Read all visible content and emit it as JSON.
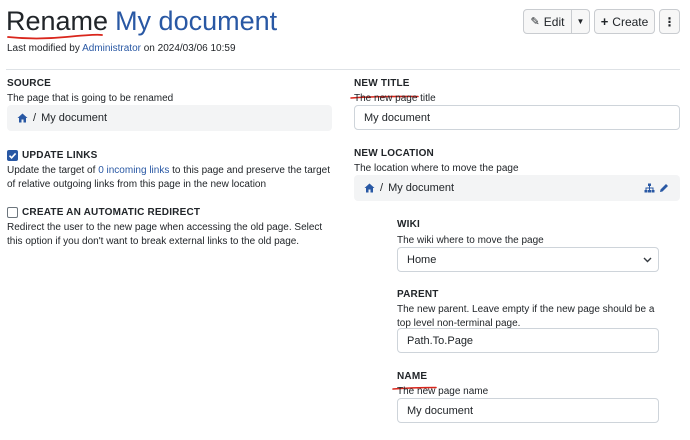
{
  "header": {
    "title_verb": "Rename",
    "title_doc": "My document",
    "meta_prefix": "Last modified by",
    "meta_user": "Administrator",
    "meta_suffix": "on 2024/03/06 10:59"
  },
  "toolbar": {
    "edit_label": "Edit",
    "create_label": "Create"
  },
  "source": {
    "label": "SOURCE",
    "hint": "The page that is going to be renamed",
    "crumb_sep": "/",
    "crumb_page": "My document"
  },
  "update_links": {
    "label": "UPDATE LINKS",
    "checked": true,
    "hint_before": "Update the target of",
    "hint_link": "0 incoming links",
    "hint_after": "to this page and preserve the target of relative outgoing links from this page in the new location"
  },
  "auto_redirect": {
    "label": "CREATE AN AUTOMATIC REDIRECT",
    "checked": false,
    "hint": "Redirect the user to the new page when accessing the old page. Select this option if you don't want to break external links to the old page."
  },
  "new_title": {
    "label": "NEW TITLE",
    "hint": "The new page title",
    "value": "My document"
  },
  "new_location": {
    "label": "NEW LOCATION",
    "hint": "The location where to move the page",
    "crumb_sep": "/",
    "crumb_page": "My document"
  },
  "wiki": {
    "label": "WIKI",
    "hint": "The wiki where to move the page",
    "selected": "Home"
  },
  "parent": {
    "label": "PARENT",
    "hint": "The new parent. Leave empty if the new page should be a top level non-terminal page.",
    "value": "Path.To.Page"
  },
  "name": {
    "label": "NAME",
    "hint": "The new page name",
    "value": "My document"
  },
  "colors": {
    "link": "#2958a4",
    "annotation": "#d9261c",
    "checkbox": "#2958a4"
  }
}
